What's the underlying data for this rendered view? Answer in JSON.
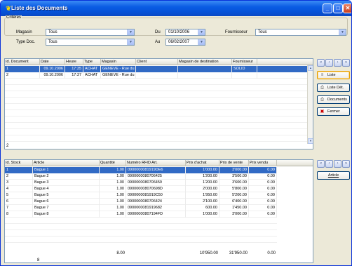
{
  "window": {
    "title": "Liste des Documents"
  },
  "criteria": {
    "legend": "Critères",
    "magasin_label": "Magasin",
    "magasin_value": "Tous",
    "typedoc_label": "Type Doc.",
    "typedoc_value": "Tous",
    "du_label": "Du",
    "du_value": "01/10/2006",
    "au_label": "Au",
    "au_value": "06/02/2007",
    "fournisseur_label": "Fournisseur",
    "fournisseur_value": "Tous"
  },
  "documents": {
    "columns": [
      "Id. Document",
      "Date",
      "Heure",
      "Type",
      "Magasin",
      "Client",
      "Magasin de destination",
      "Fournisseur"
    ],
    "rows": [
      [
        "1",
        "09.10.2006",
        "17:35",
        "ACHAT",
        "GENEVE - Rue du",
        "",
        "",
        "SOLID"
      ],
      [
        "2",
        "09.10.2006",
        "17:37",
        "ACHAT",
        "GENEVE - Rue du",
        "",
        "",
        ""
      ]
    ],
    "count": "2"
  },
  "side_buttons": {
    "liste": "Liste",
    "liste_det": "Liste Dét.",
    "documents": "Documents",
    "fermer": "Fermer",
    "article": "Article"
  },
  "stock": {
    "columns": [
      "Id. Stock",
      "Article",
      "Quantité",
      "Numéro RFID Art.",
      "Prix d'achat",
      "Prix de vente",
      "Prix vendu"
    ],
    "rows": [
      [
        "1",
        "Bague 1",
        "1.00",
        "0900000081919DE6",
        "1'000.00",
        "3'000.00",
        "0.00"
      ],
      [
        "2",
        "Bague 2",
        "1.00",
        "0900000080706425",
        "1'200.00",
        "3'500.00",
        "0.00"
      ],
      [
        "3",
        "Bague 3",
        "1.00",
        "0900000080706459",
        "1'200.00",
        "3'600.00",
        "0.00"
      ],
      [
        "4",
        "Bague 4",
        "1.00",
        "090000008070698D",
        "2'000.00",
        "5'800.00",
        "0.00"
      ],
      [
        "5",
        "Bague 5",
        "1.00",
        "0900000081919C50",
        "1'950.00",
        "5'200.00",
        "0.00"
      ],
      [
        "6",
        "Bague 6",
        "1.00",
        "0900000080706424",
        "2'100.00",
        "6'400.00",
        "0.00"
      ],
      [
        "7",
        "Bague 7",
        "1.00",
        "0900000081919682",
        "600.00",
        "1'450.00",
        "0.00"
      ],
      [
        "8",
        "Bague 8",
        "1.00",
        "09000000807194FD",
        "1'000.00",
        "3'000.00",
        "0.00"
      ]
    ],
    "totals": {
      "quantite": "8.00",
      "prix_achat": "10'950.00",
      "prix_vente": "31'950.00",
      "prix_vendu": "0.00"
    },
    "count": "8"
  },
  "colors": {
    "title_bar": "#0a5ce4",
    "selection": "#316ac5",
    "window_bg": "#ece9d8"
  }
}
